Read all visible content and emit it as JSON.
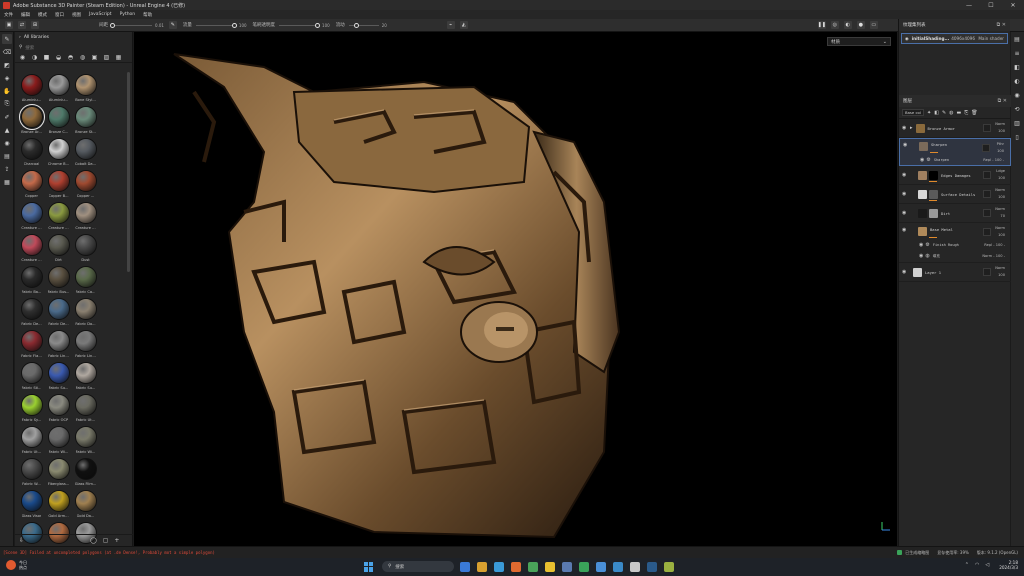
{
  "window": {
    "title": "Adobe Substance 3D Painter (Steam Edition) - Unreal Engine 4 (已修)"
  },
  "menu": [
    "文件",
    "编辑",
    "模式",
    "窗口",
    "视图",
    "JavaScript",
    "Python",
    "帮助"
  ],
  "toolbar": {
    "values": [
      "0.01",
      "100",
      "100",
      "20"
    ],
    "labels": [
      "间距",
      "流量",
      "笔刷透明度",
      "流动"
    ]
  },
  "shelf": {
    "header": "All libraries",
    "search_placeholder": "搜索",
    "materials": [
      {
        "label": "Aluminiu...",
        "color": "#8a1c1c"
      },
      {
        "label": "Aluminiu...",
        "color": "#9a9a9a"
      },
      {
        "label": "Bone Styl...",
        "color": "#b09370"
      },
      {
        "label": "",
        "color": "#3a3a3a"
      },
      {
        "label": "Bronze Ar...",
        "color": "#8f6a3c"
      },
      {
        "label": "Bronze C...",
        "color": "#4f7a6a"
      },
      {
        "label": "Bronze St...",
        "color": "#6a8a7a"
      },
      {
        "label": "",
        "color": "#3a3a3a"
      },
      {
        "label": "Charcoal",
        "color": "#2b2b2b"
      },
      {
        "label": "Chrome B...",
        "color": "#d0d0d0"
      },
      {
        "label": "Cobalt Da...",
        "color": "#555a60"
      },
      {
        "label": "",
        "color": "#3a3a3a"
      },
      {
        "label": "Copper",
        "color": "#c46a4a"
      },
      {
        "label": "Copper B...",
        "color": "#b04030"
      },
      {
        "label": "Copper ...",
        "color": "#a04a30"
      },
      {
        "label": "",
        "color": "#3a3a3a"
      },
      {
        "label": "Creature ...",
        "color": "#4a6aa0"
      },
      {
        "label": "Creature ...",
        "color": "#8a9a40"
      },
      {
        "label": "Creature ...",
        "color": "#a09080"
      },
      {
        "label": "",
        "color": "#3a3a3a"
      },
      {
        "label": "Creature ...",
        "color": "#c04a5a"
      },
      {
        "label": "Dirt",
        "color": "#5a5a50"
      },
      {
        "label": "Dust",
        "color": "#4a4a4a"
      },
      {
        "label": "",
        "color": "#3a3a3a"
      },
      {
        "label": "Fabric Ba...",
        "color": "#2a2a2a"
      },
      {
        "label": "Fabric Bus...",
        "color": "#5a5040"
      },
      {
        "label": "Fabric Ca...",
        "color": "#5a6a4a"
      },
      {
        "label": "",
        "color": "#3a3a3a"
      },
      {
        "label": "Fabric De...",
        "color": "#2f2f2f"
      },
      {
        "label": "Fabric De...",
        "color": "#4a6a8a"
      },
      {
        "label": "Fabric Do...",
        "color": "#8a8070"
      },
      {
        "label": "",
        "color": "#3a3a3a"
      },
      {
        "label": "Fabric Fla...",
        "color": "#8a2a30"
      },
      {
        "label": "Fabric Lin...",
        "color": "#8a8a8a"
      },
      {
        "label": "Fabric Lin...",
        "color": "#7a7a7a"
      },
      {
        "label": "",
        "color": "#3a3a3a"
      },
      {
        "label": "Fabric Sti...",
        "color": "#6a6a6a"
      },
      {
        "label": "Fabric Su...",
        "color": "#3a5ab0"
      },
      {
        "label": "Fabric Su...",
        "color": "#b0a8a0"
      },
      {
        "label": "",
        "color": "#3a3a3a"
      },
      {
        "label": "Fabric Sy...",
        "color": "#9ad030"
      },
      {
        "label": "Fabric OCP",
        "color": "#8a8a80"
      },
      {
        "label": "Fabric Ut...",
        "color": "#6a6a60"
      },
      {
        "label": "",
        "color": "#3a3a3a"
      },
      {
        "label": "Fabric Ut...",
        "color": "#a0a0a0"
      },
      {
        "label": "Fabric Wi...",
        "color": "#6a6a6a"
      },
      {
        "label": "Fabric Wi...",
        "color": "#7a7a6a"
      },
      {
        "label": "",
        "color": "#3a3a3a"
      },
      {
        "label": "Fabric W...",
        "color": "#4a4a4a"
      },
      {
        "label": "Fiberglass...",
        "color": "#8a8a70"
      },
      {
        "label": "Glass Film...",
        "color": "#101010"
      },
      {
        "label": "",
        "color": "#3a3a3a"
      },
      {
        "label": "Glass Visor",
        "color": "#1a4a8a"
      },
      {
        "label": "Gold Arm...",
        "color": "#c0a020"
      },
      {
        "label": "Gold Da...",
        "color": "#a08050"
      },
      {
        "label": "",
        "color": "#3a3a3a"
      },
      {
        "label": "",
        "color": "#3a6a8a"
      },
      {
        "label": "",
        "color": "#b06a40"
      },
      {
        "label": "",
        "color": "#9a9a9a"
      },
      {
        "label": "",
        "color": "#3a3a3a"
      }
    ]
  },
  "viewport": {
    "display_mode": "材质"
  },
  "texture_set": {
    "panel_title": "纹理集列表",
    "name": "initialShading...",
    "resolution": "4096x4096",
    "shader": "Main shader"
  },
  "layers": {
    "panel_title": "图层",
    "blend_mode": "Base col",
    "items": [
      {
        "name": "Bronze Armor",
        "blend": "Norm",
        "opacity": "100",
        "thumb": "#8a6a3c",
        "thumb2": "",
        "type": "folder",
        "selected": false
      },
      {
        "name": "Sharpen",
        "blend": "Pthr",
        "opacity": "100",
        "thumb": "#7a6a5a",
        "thumb2": "",
        "type": "layer",
        "selected": true
      },
      {
        "name": "Edges Damages",
        "blend": "Ldge",
        "opacity": "100",
        "thumb": "#a08060",
        "thumb2": "#000000",
        "type": "layer",
        "selected": false
      },
      {
        "name": "Surface Details",
        "blend": "Norm",
        "opacity": "100",
        "thumb": "#d8d8d8",
        "thumb2": "#5a5a5a",
        "type": "layer",
        "selected": false
      },
      {
        "name": "Dirt",
        "blend": "Norm",
        "opacity": "70",
        "thumb": "#1a1a1a",
        "thumb2": "#9a9a9a",
        "type": "layer",
        "selected": false
      },
      {
        "name": "Base Metal",
        "blend": "Norm",
        "opacity": "100",
        "thumb": "#b08a5a",
        "thumb2": "",
        "type": "layer",
        "selected": false
      },
      {
        "name": "Layer 1",
        "blend": "Norm",
        "opacity": "100",
        "thumb": "#d0d0d0",
        "thumb2": "",
        "type": "layer",
        "selected": false
      }
    ],
    "sub_sharpen": {
      "name": "Sharpen",
      "value": "Repl - 100 -"
    },
    "sub_base1": {
      "name": "Finish Rough",
      "value": "Repl - 100 -"
    },
    "sub_base2": {
      "name": "填充",
      "value": "Norm - 100 -"
    }
  },
  "status": {
    "error": "[Scene 3D] Failed at uncompleted polygons (at .de Dense!, Probably mot a simple polygon)",
    "items": [
      "已生成缩略图",
      "显存使用率: 39%",
      "版本: 9.1.2 (OpenGL)"
    ]
  },
  "taskbar": {
    "weather_line1": "今日",
    "weather_line2": "热点",
    "search": "搜索",
    "time": "2:18",
    "date": "2024/3/3",
    "apps": [
      "#3a7ad8",
      "#d8a030",
      "#3a9ad8",
      "#e06a30",
      "#4aa35a",
      "#e8c030",
      "#5a7ab0",
      "#3aa35a",
      "#4a90d8",
      "#3a8ac8",
      "#c8c8c8",
      "#2a5a8a",
      "#9ab040"
    ]
  }
}
